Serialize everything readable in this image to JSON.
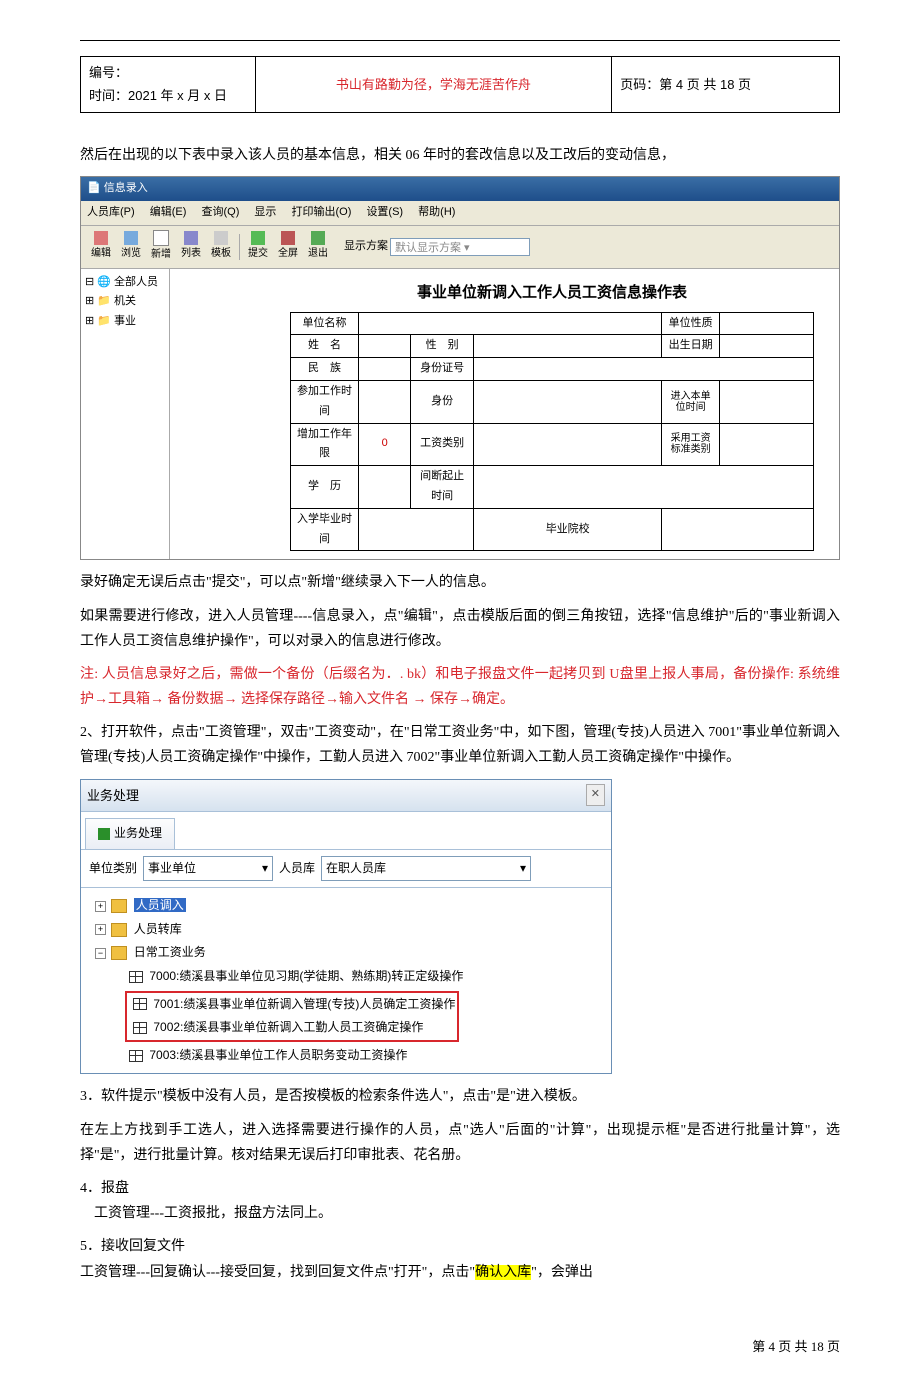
{
  "header": {
    "left_line1": "编号：",
    "left_line2": "时间：2021 年 x 月 x 日",
    "middle": "书山有路勤为径，学海无涯苦作舟",
    "right": "页码：第 4 页  共 18 页"
  },
  "para1": "然后在出现的以下表中录入该人员的基本信息，相关 06 年时的套改信息以及工改后的变动信息，",
  "ss1": {
    "title_icon": "📄",
    "title": "信息录入",
    "menus": [
      "人员库(P)",
      "编辑(E)",
      "查询(Q)",
      "显示",
      "打印输出(O)",
      "设置(S)",
      "帮助(H)"
    ],
    "tools": [
      "编辑",
      "浏览",
      "新增",
      "列表",
      "模板",
      "提交",
      "全屏",
      "退出"
    ],
    "scheme_label": "显示方案",
    "scheme_value": "默认显示方案",
    "tree": [
      "⊟ 🌐 全部人员",
      "  ⊞ 📁 机关",
      "  ⊞ 📁 事业"
    ],
    "form_title": "事业单位新调入工作人员工资信息操作表",
    "rows": {
      "r1c1": "单位名称",
      "r1c3": "单位性质",
      "r2c1": "姓　名",
      "r2c2": "性　别",
      "r2c3": "出生日期",
      "r3c1": "民　族",
      "r3c2": "身份证号",
      "r4c1": "参加工作时间",
      "r4c2": "身份",
      "r4c3": "进入本单位时间",
      "r5c1": "增加工作年限",
      "r5v": "0",
      "r5c2": "工资类别",
      "r5c3": "采用工资标准类别",
      "r6c1": "学　历",
      "r6c2": "间断起止时间",
      "r7c1": "入学毕业时间",
      "r7c2": "毕业院校"
    }
  },
  "para2": "录好确定无误后点击\"提交\"，可以点\"新增\"继续录入下一人的信息。",
  "para3": "如果需要进行修改，进入人员管理----信息录入，点\"编辑\"，点击模版后面的倒三角按钮，选择\"信息维护\"后的\"事业新调入工作人员工资信息维护操作\"，可以对录入的信息进行修改。",
  "para4_red": "注: 人员信息录好之后，需做一个备份（后缀名为．.  bk）和电子报盘文件一起拷贝到 U盘里上报人事局，备份操作: 系统维护→工具箱→  备份数据→  选择保存路径→输入文件名  →  保存→确定。",
  "para5": "2、打开软件，点击\"工资管理\"，双击\"工资变动\"，在\"日常工资业务\"中，如下图，管理(专技)人员进入 7001\"事业单位新调入管理(专技)人员工资确定操作\"中操作，工勤人员进入 7002\"事业单位新调入工勤人员工资确定操作\"中操作。",
  "ss2": {
    "title": "业务处理",
    "close": "✕",
    "tab": "业务处理",
    "label1": "单位类别",
    "value1": "事业单位",
    "label2": "人员库",
    "value2": "在职人员库",
    "tree": {
      "t1": "人员调入",
      "t2": "人员转库",
      "t3": "日常工资业务",
      "i0": "7000:绩溪县事业单位见习期(学徒期、熟练期)转正定级操作",
      "i1": "7001:绩溪县事业单位新调入管理(专技)人员确定工资操作",
      "i2": "7002:绩溪县事业单位新调入工勤人员工资确定操作",
      "i3": "7003:绩溪县事业单位工作人员职务变动工资操作"
    }
  },
  "para6": "3．软件提示\"模板中没有人员，是否按模板的检索条件选人\"，点击\"是\"进入模板。",
  "para7": "在左上方找到手工选人，进入选择需要进行操作的人员，点\"选人\"后面的\"计算\"，出现提示框\"是否进行批量计算\"，选择\"是\"，进行批量计算。核对结果无误后打印审批表、花名册。",
  "para8_h": "4．报盘",
  "para8_b": "　工资管理---工资报批，报盘方法同上。",
  "para9_h": "5．接收回复文件",
  "para9_b_pre": "工资管理---回复确认---接受回复，找到回复文件点\"打开\"，点击\"",
  "para9_b_hl": "确认入库",
  "para9_b_post": "\"，会弹出",
  "footer": "第  4  页  共  18  页"
}
